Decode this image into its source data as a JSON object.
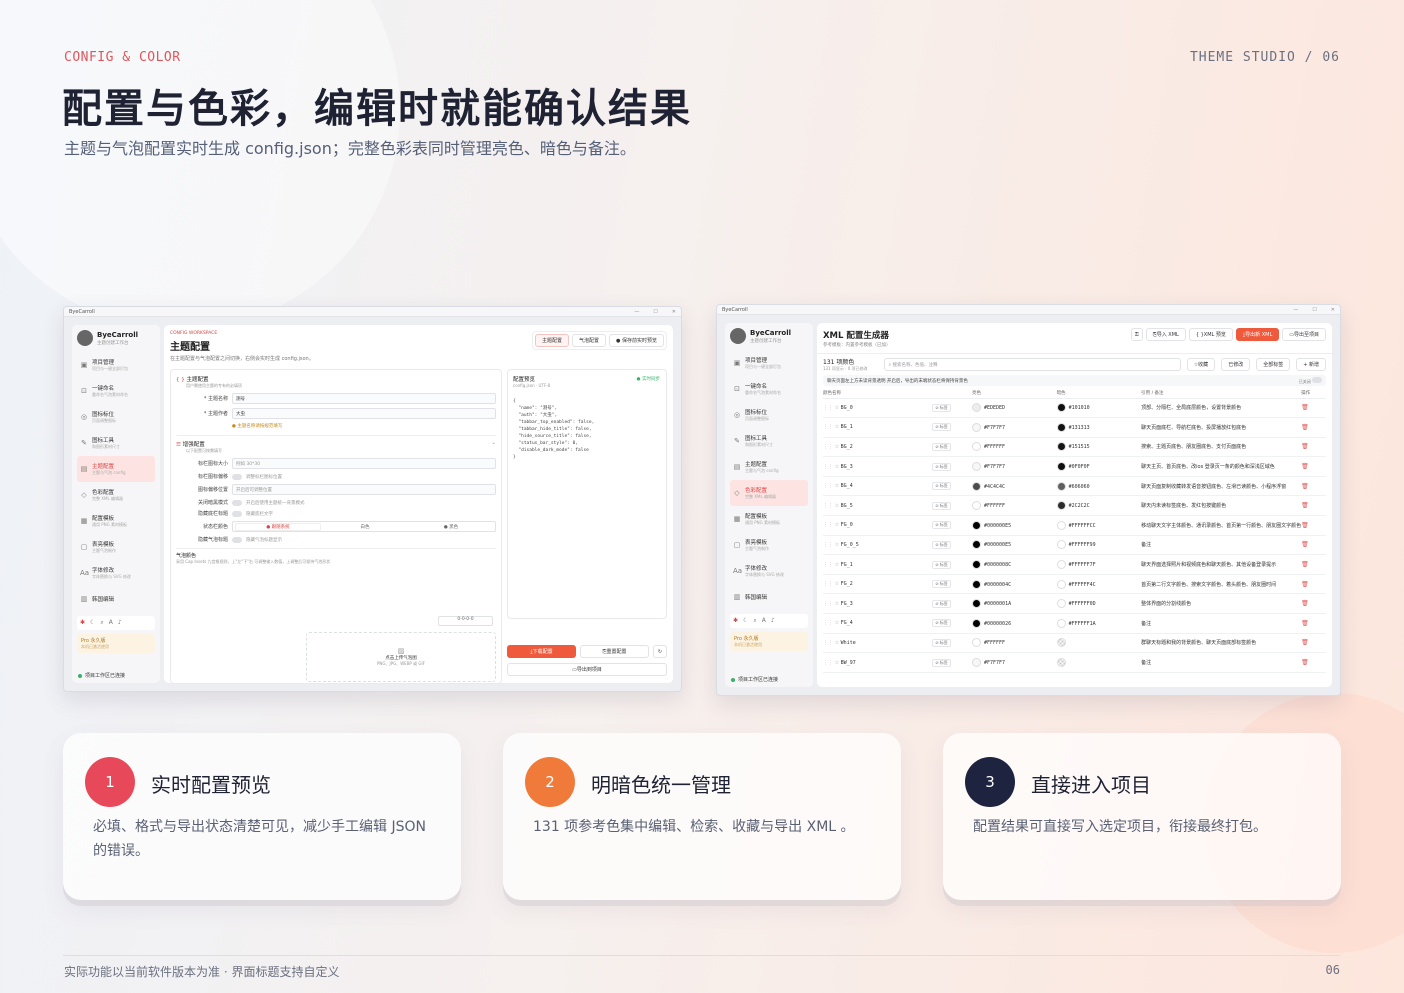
{
  "header": {
    "eyebrow": "CONFIG & COLOR",
    "studio": "THEME STUDIO  /  06",
    "title": "配置与色彩，编辑时就能确认结果",
    "subtitle": "主题与气泡配置实时生成 config.json；完整色彩表同时管理亮色、暗色与备注。"
  },
  "shot1": {
    "window_title": "ByeCarroll",
    "brand": "ByeCarroll",
    "brand_sub": "主题创建工作台",
    "nav": [
      {
        "label": "项目管理",
        "sub": "项目与一键全部打包"
      },
      {
        "label": "一键命名",
        "sub": "重命名气泡素材命名"
      },
      {
        "label": "图标标位",
        "sub": "页面调整图标"
      },
      {
        "label": "图标工具",
        "sub": "和图形素材尺寸"
      },
      {
        "label": "主题配置",
        "sub": "主题与气泡 config"
      },
      {
        "label": "色彩配置",
        "sub": "完整 XML 编辑器"
      },
      {
        "label": "配置模板",
        "sub": "通用 PNG 素材模板"
      },
      {
        "label": "表亮模板",
        "sub": "主题气泡制作"
      },
      {
        "label": "字体修改",
        "sub": "字体替换与 SVG 修改"
      },
      {
        "label": "韩国编辑",
        "sub": ""
      }
    ],
    "pro_label": "Pro 永久版",
    "pro_sub": "本机已激活使用",
    "status": "项目工作区已连接",
    "workspace_tag": "CONFIG WORKSPACE",
    "page_title": "主题配置",
    "page_desc": "在主题配置与气泡配置之间切换，右侧会实时生成 config.json。",
    "tabs": [
      "主题配置",
      "气泡配置",
      "● 保存前实时预览"
    ],
    "section_theme": "主题配置",
    "section_theme_sub": "用户需使用主题的专有的必填项",
    "field_name_label": "* 主题名称",
    "field_name_value": "测号",
    "field_author_label": "* 主题作者",
    "field_author_value": "大虫",
    "warning": "主题名称请按规范填写",
    "section_adv": "增强配置",
    "section_adv_sub": "以下配置可按需填写",
    "adv_fields": [
      {
        "label": "标栏图标大小",
        "placeholder": "例如 30*30"
      },
      {
        "label": "标栏图标偏移",
        "placeholder": "调整标栏图标位置"
      },
      {
        "label": "图标偏移位置",
        "placeholder": "开启后可调整位置"
      },
      {
        "label": "关闭暗黑模式",
        "placeholder": "开启后使用主题统一背景模式"
      },
      {
        "label": "隐藏底栏标题",
        "placeholder": "隐藏底栏文字"
      },
      {
        "label": "状态栏颜色",
        "placeholder": ""
      },
      {
        "label": "隐藏气泡标题",
        "placeholder": "隐藏气泡标题显示"
      }
    ],
    "statusbar_options": [
      "● 跟随系统",
      "白色",
      "● 黑色"
    ],
    "bubble_label": "气泡颜色",
    "bubble_desc": "采用 Cap Insets 九宫格规则，上\"左\"下\"右 可调整输入数值，上调整后可保持气泡形状",
    "bubble_value": "0-0-0-0",
    "upload_title": "点击上传气泡图",
    "upload_sub": "PNG、JPG、WEBP 或 GIF",
    "preview_title": "配置预览",
    "preview_sub": "config.json · UTF-8",
    "preview_status": "● 实时同步",
    "code": "{\n  \"name\": \"测号\",\n  \"auth\": \"大虫\",\n  \"tabbar_top_enabled\": false,\n  \"tabbar_hide_title\": false,\n  \"hide_source_title\": false,\n  \"status_bar_style\": 0,\n  \"disable_dark_mode\": false\n}",
    "download_btn": "下载配置",
    "reset_btn": "重置配置",
    "export_btn": "导出到项目"
  },
  "shot2": {
    "window_title": "ByeCarroll",
    "brand": "ByeCarroll",
    "brand_sub": "主题创建工作台",
    "nav": [
      {
        "label": "项目管理",
        "sub": "项目与一键全部打包"
      },
      {
        "label": "一键命名",
        "sub": "重命名气泡素材命名"
      },
      {
        "label": "图标标位",
        "sub": "页面调整图标"
      },
      {
        "label": "图标工具",
        "sub": "和图形素材尺寸"
      },
      {
        "label": "主题配置",
        "sub": "主题与气泡 config"
      },
      {
        "label": "色彩配置",
        "sub": "完整 XML 编辑器"
      },
      {
        "label": "配置模板",
        "sub": "通用 PNG 素材模板"
      },
      {
        "label": "表亮模板",
        "sub": "主题气泡制作"
      },
      {
        "label": "字体修改",
        "sub": "字体替换与 SVG 修改"
      },
      {
        "label": "韩国编辑",
        "sub": ""
      }
    ],
    "pro_label": "Pro 永久版",
    "pro_sub": "本机已激活使用",
    "status": "项目工作区已连接",
    "page_title": "XML 配置生成器",
    "page_desc": "参考模板：内置参考模板（已加）",
    "actions": [
      "导入 XML",
      "XML 预览",
      "导出新 XML",
      "导出至项目"
    ],
    "count": "131 项颜色",
    "count_sub": "131 项显示 · 0 项已修改",
    "search_placeholder": "搜索名称、色值、注释",
    "filter_buttons": [
      "收藏",
      "已修改",
      "全部标签",
      "+ 新增"
    ],
    "notice": "聊天页面左上方未读背景透明 开启后，导出的末端状态栏将保持背景色",
    "notice_toggle": "已关闭",
    "columns": [
      "颜色名称",
      "",
      "亮色",
      "暗色",
      "引用 / 备注",
      "操作"
    ],
    "rows": [
      {
        "name": "BG_0",
        "light": "#EDEDED",
        "lc": "#EDEDED",
        "dark": "#101010",
        "dc": "#101010",
        "note": "顶部、分隔栏、全局底层颜色，设置背景颜色"
      },
      {
        "name": "BG_1",
        "light": "#F7F7F7",
        "lc": "#F7F7F7",
        "dark": "#131313",
        "dc": "#131313",
        "note": "聊天页面底栏、导航栏底色、投屏播放红包底色"
      },
      {
        "name": "BG_2",
        "light": "#FFFFFF",
        "lc": "#FFFFFF",
        "dark": "#151515",
        "dc": "#151515",
        "note": "搜索、主题页底色、朋友圈底色、支付页面底色"
      },
      {
        "name": "BG_3",
        "light": "#F7F7F7",
        "lc": "#F7F7F7",
        "dark": "#0F0F0F",
        "dc": "#0F0F0F",
        "note": "聊天主页、首页底色、改ios 登录页一条的颜色和深浅区域色"
      },
      {
        "name": "BG_4",
        "light": "#4C4C4C",
        "lc": "#4C4C4C",
        "dark": "#606060",
        "dc": "#606060",
        "note": "聊天页面复制收藏转发语音按钮底色、左滑已读颜色、小程序浮窗"
      },
      {
        "name": "BG_5",
        "light": "#FFFFFF",
        "lc": "#FFFFFF",
        "dark": "#2C2C2C",
        "dc": "#2C2C2C",
        "note": "聊天内未读标签底色、发红包按键颜色"
      },
      {
        "name": "FG_0",
        "light": "#000000E5",
        "lc": "#000000",
        "dark": "#FFFFFFCC",
        "dc": "#FFFFFF",
        "note": "移动聊天文字主体颜色、通讯录颜色、首页第一行颜色、朋友圈文字颜色"
      },
      {
        "name": "FG_0_5",
        "light": "#000000E5",
        "lc": "#000000",
        "dark": "#FFFFFF99",
        "dc": "#FFFFFF",
        "note": "备注"
      },
      {
        "name": "FG_1",
        "light": "#0000008C",
        "lc": "#000000",
        "dark": "#FFFFFF7F",
        "dc": "#FFFFFF",
        "note": "聊天界面选择照片和视频底色和聊天颜色、其他设备登录提示"
      },
      {
        "name": "FG_2",
        "light": "#0000004C",
        "lc": "#000000",
        "dark": "#FFFFFF4C",
        "dc": "#FFFFFF",
        "note": "首页第二行文字颜色、搜索文字颜色、着头颜色、朋友圈时间"
      },
      {
        "name": "FG_3",
        "light": "#0000001A",
        "lc": "#000000",
        "dark": "#FFFFFF0D",
        "dc": "#FFFFFF",
        "note": "整体界面的分割线颜色"
      },
      {
        "name": "FG_4",
        "light": "#00000026",
        "lc": "#000000",
        "dark": "#FFFFFF1A",
        "dc": "#FFFFFF",
        "note": "备注"
      },
      {
        "name": "White",
        "light": "#FFFFFF",
        "lc": "#FFFFFF",
        "dark": "",
        "dc": "checker",
        "note": "群聊天标题和我的背景颜色、聊天页面底部标签颜色"
      },
      {
        "name": "BW_97",
        "light": "#F7F7F7",
        "lc": "#F7F7F7",
        "dark": "",
        "dc": "checker",
        "note": "备注"
      }
    ],
    "tag_label": "标签"
  },
  "cards": [
    {
      "num": "1",
      "title": "实时配置预览",
      "desc": "必填、格式与导出状态清楚可见，减少手工编辑 JSON 的错误。",
      "color": "#e8495a"
    },
    {
      "num": "2",
      "title": "明暗色统一管理",
      "desc": "131 项参考色集中编辑、检索、收藏与导出 XML 。",
      "color": "#f07a3a"
    },
    {
      "num": "3",
      "title": "直接进入项目",
      "desc": "配置结果可直接写入选定项目，衔接最终打包。",
      "color": "#1e2340"
    }
  ],
  "footer": {
    "left": "实际功能以当前软件版本为准 · 界面标题支持自定义",
    "right": "06"
  }
}
